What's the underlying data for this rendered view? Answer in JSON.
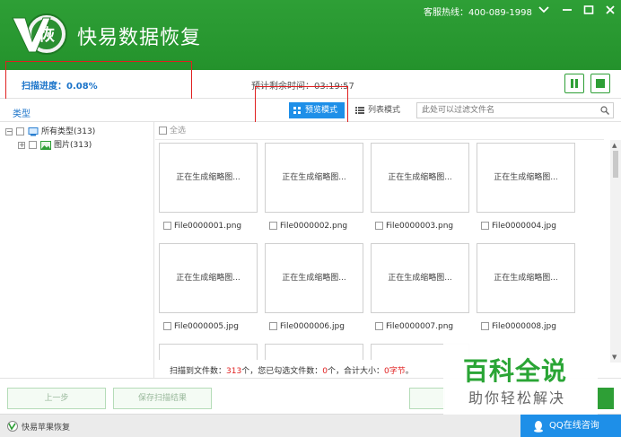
{
  "window": {
    "title": "快易数据恢复",
    "logo_text": "恢",
    "hotline": "客服热线：400-089-1998"
  },
  "progress": {
    "scan_progress": "扫描进度：0.08%",
    "remaining_time": "预计剩余时间：03:19:57"
  },
  "toolbar": {
    "type_label": "类型",
    "preview_mode": "预览模式",
    "list_mode": "列表模式",
    "filter_placeholder": "此处可以过滤文件名"
  },
  "tree": {
    "root": "所有类型(313)",
    "child": "图片(313)"
  },
  "content": {
    "select_all": "全选",
    "thumb_text": "正在生成缩略图...",
    "files": [
      "File0000001.png",
      "File0000002.png",
      "File0000003.png",
      "File0000004.jpg",
      "File0000005.jpg",
      "File0000006.jpg",
      "File0000007.png",
      "File0000008.jpg"
    ]
  },
  "status": {
    "found_label": "扫描到文件数：",
    "found_count": "313",
    "found_unit": "个，您已勾选文件数：",
    "selected_count": "0",
    "selected_unit": "个，合计大小：",
    "total_size": "0字节",
    "end": "。"
  },
  "buttons": {
    "prev": "上一步",
    "save_result": "保存扫描结果"
  },
  "footer": {
    "apple_recovery": "快易苹果恢复",
    "qq_consult": "QQ在线咨询"
  },
  "watermark": {
    "title": "百科全说",
    "subtitle": "助你轻松解决"
  },
  "colors": {
    "brand_green": "#2e9f36",
    "accent_blue": "#1e8fe8",
    "highlight_red": "#e02020"
  }
}
